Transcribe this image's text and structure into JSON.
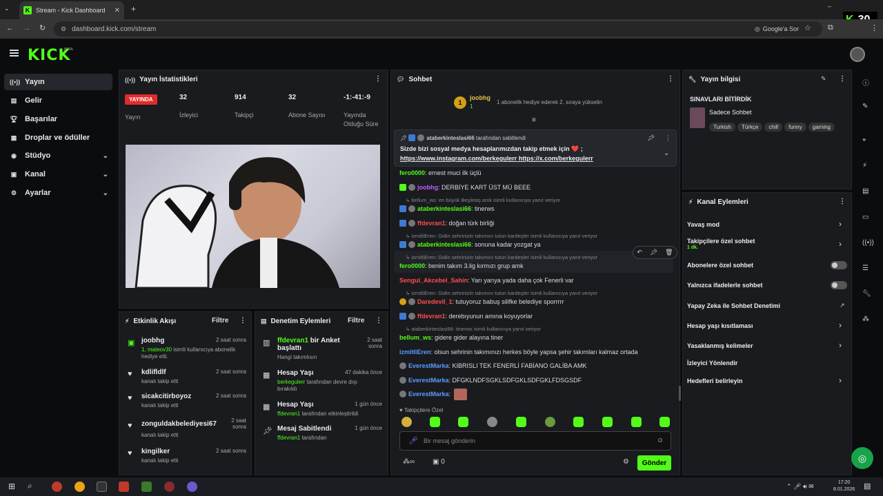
{
  "browser": {
    "tab_title": "Stream - Kick Dashboard",
    "url": "dashboard.kick.com/stream",
    "google_sor": "Google'a Sor"
  },
  "overlay": {
    "k": "K",
    "num": "30"
  },
  "header": {
    "logo": "KICK",
    "beta": "BETA"
  },
  "sidebar": {
    "items": [
      {
        "label": "Yayın",
        "icon": "broadcast-icon"
      },
      {
        "label": "Gelir",
        "icon": "revenue-icon"
      },
      {
        "label": "Başarılar",
        "icon": "trophy-icon"
      },
      {
        "label": "Droplar ve ödüller",
        "icon": "drops-icon"
      },
      {
        "label": "Stüdyo",
        "icon": "studio-icon"
      },
      {
        "label": "Kanal",
        "icon": "channel-icon"
      },
      {
        "label": "Ayarlar",
        "icon": "settings-icon"
      }
    ]
  },
  "stats": {
    "title": "Yayın İstatistikleri",
    "live_label": "YAYINDA",
    "live_sub": "Yayın",
    "items": [
      {
        "value": "32",
        "label": "İzleyici"
      },
      {
        "value": "914",
        "label": "Takipçi"
      },
      {
        "value": "32",
        "label": "Abone Sayısı"
      },
      {
        "value": "-1:-41:-9",
        "label": "Yayında Olduğu Süre"
      }
    ]
  },
  "activity": {
    "title": "Etkinlik Akışı",
    "filter": "Filtre",
    "items": [
      {
        "name": "joobhg",
        "sub_green": "1, mateov30",
        "sub": " isimli kullanıcıya abonelik hediye etti.",
        "time": "2 saat sonra"
      },
      {
        "name": "kdlifldlf",
        "sub": "kanalı takip etti",
        "time": "2 saat sonra"
      },
      {
        "name": "sicakcitirboyoz",
        "sub": "kanalı takip etti",
        "time": "2 saat sonra"
      },
      {
        "name": "zonguldakbelediyesi67",
        "sub": "kanalı takip etti",
        "time": "2 saat sonra"
      },
      {
        "name": "kingilker",
        "sub": "kanalı takip etti",
        "time": "2 saat sonra"
      }
    ]
  },
  "mod": {
    "title": "Denetim Eylemleri",
    "filter": "Filtre",
    "items": [
      {
        "title_green": "ffdevran1",
        "title": " bir Anket başlattı",
        "sub": "Hangi takımlısın",
        "time": "2 saat sonra"
      },
      {
        "title": "Hesap Yaşı",
        "sub_green": "berkegulerr",
        "sub": " tarafından devre dışı bırakıldı",
        "time": "47 dakika önce"
      },
      {
        "title": "Hesap Yaşı",
        "sub_green": "ffdevran1",
        "sub": " tarafından etkinleştirildi",
        "time": "1 gün önce"
      },
      {
        "title": "Mesaj Sabitlendi",
        "sub_green": "ffdevran1",
        "sub": " tarafından",
        "time": "1 gün önce"
      }
    ]
  },
  "chat": {
    "title": "Sohbet",
    "top_user": "joobhg",
    "top_count": "1",
    "top_note": "1 abonelik hediye ederek 2. sıraya yükselin",
    "pinned_by": "ataberkinteslasi66",
    "pinned_by_suffix": " tarafından sabitlendi",
    "pinned_text": "Sizde bizi sosyal medya hesaplarımızdan takip etmek için",
    "pinned_emoji": "❤️",
    "pinned_semicolon": ";",
    "pinned_link1": "https://www.instagram.com/berkegulerr",
    "pinned_link2": "https://x.com/berkegulerr",
    "lines": [
      {
        "user": "fero0000",
        "color": "#53fc18",
        "text": ": ernest muci ilk üçlü"
      },
      {
        "user": "joobhg",
        "color": "#c45cff",
        "text": ": DERBİYE KART ÜST MÜ BEEE"
      },
      {
        "reply": "bellum_ws: en büyük Beşiktaş amk isimli kullanıcıya yanıt veriyor"
      },
      {
        "user": "ataberkinteslasi66",
        "color": "#53fc18",
        "text": ": tinerws"
      },
      {
        "user": "ffdevran1",
        "color": "#ff4d4d",
        "text": ": doğan türk birliği"
      },
      {
        "reply": "izmitliEren: Gidin sehrinizin takımını tutun kardeşler isimli kullanıcıya yanıt veriyor"
      },
      {
        "user": "ataberkinteslasi66",
        "color": "#53fc18",
        "text": ": sonuna kadar yozgat ya"
      },
      {
        "reply": "izmitliEren: Gidin sehrinizin takımını tutun kardeşler isimli kullanıcıya yanıt veriyor"
      },
      {
        "user": "fero0000",
        "color": "#53fc18",
        "text": ": benim takım 3.lig kırmızı grup amk"
      },
      {
        "user": "Sengul_Akcebel_Sahin",
        "color": "#ff4d4d",
        "text": ": Yarı yarıya yada daha çok Fenerli var"
      },
      {
        "reply": "izmitliEren: Gidin sehrinizin takımını tutun kardeşler isimli kullanıcıya yanıt veriyor"
      },
      {
        "user": "Daredevil_1",
        "color": "#ff4d4d",
        "text": ": tutuyoruz babuş silifke belediye sporrrrr"
      },
      {
        "user": "ffdevran1",
        "color": "#ff4d4d",
        "text": ": derebıyunun amına koyuyorlar"
      },
      {
        "reply": "ataberkinteslasi66: tinerws isimli kullanıcıya yanıt veriyor"
      },
      {
        "user": "bellum_ws",
        "color": "#53fc18",
        "text": ": gidere gider alayına tiner"
      },
      {
        "user": "izmitliEren",
        "color": "#5b9cff",
        "text": ": olsun sehrinin takımınızı herkes böyle yapsa şehir takımları kalmaz ortada"
      },
      {
        "user": "EverestMarka",
        "color": "#5b9cff",
        "text": ": KIBRISLI TEK FENERLİ FABİANO GALİBA AMK"
      },
      {
        "user": "EverestMarka",
        "color": "#5b9cff",
        "text": ": DFGKLNDFSGKLSDFGKLSDFGKLFDSGSDF"
      },
      {
        "user": "EverestMarka",
        "color": "#5b9cff",
        "text": ":"
      }
    ],
    "followers_only": "Takipçilere Özel",
    "placeholder": "Bir mesaj gönderin",
    "send": "Gönder",
    "infinity": "∞",
    "zero": "0"
  },
  "info": {
    "title": "Yayın bilgisi",
    "stream_title": "SINAVLARI BİTİRDİK",
    "category": "Sadece Sohbet",
    "tags": [
      "Turkish",
      "Türkçe",
      "chill",
      "funny",
      "gaming"
    ]
  },
  "actions": {
    "title": "Kanal Eylemleri",
    "items": [
      {
        "label": "Yavaş mod",
        "type": "chevron"
      },
      {
        "label": "Takipçilere özel sohbet",
        "sub": "1 dk.",
        "type": "chevron"
      },
      {
        "label": "Abonelere özel sohbet",
        "type": "toggle"
      },
      {
        "label": "Yalnızca ifadelerle sohbet",
        "type": "toggle"
      },
      {
        "label": "Yapay Zeka ile Sohbet Denetimi",
        "type": "external"
      },
      {
        "label": "Hesap yaşı kısıtlaması",
        "type": "chevron"
      },
      {
        "label": "Yasaklanmış kelimeler",
        "type": "chevron"
      },
      {
        "label": "İzleyici Yönlendir",
        "type": "none"
      },
      {
        "label": "Hedefleri belirleyin",
        "type": "chevron"
      }
    ]
  },
  "taskbar": {
    "time": "17:20",
    "date": "8.01.2026"
  }
}
